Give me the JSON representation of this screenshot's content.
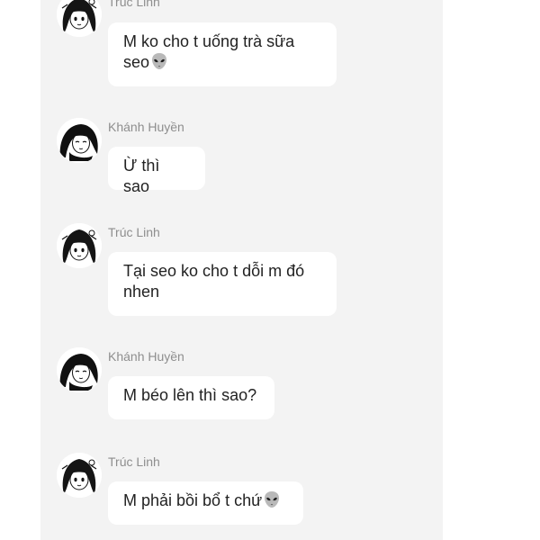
{
  "messages": [
    {
      "sender": "Trúc Linh",
      "avatar_icon": "girl-sketch-avatar-icon",
      "text_lines": [
        "M ko cho t uống trà sữa",
        "seo"
      ],
      "trailing_emoji": "alien-emoji-icon"
    },
    {
      "sender": "Khánh Huyền",
      "avatar_icon": "girl-ink-avatar-icon",
      "text_lines": [
        "Ừ thì sao"
      ]
    },
    {
      "sender": "Trúc Linh",
      "avatar_icon": "girl-sketch-avatar-icon",
      "text_lines": [
        "Tại seo ko cho t dỗi m đó",
        "nhen"
      ]
    },
    {
      "sender": "Khánh Huyền",
      "avatar_icon": "girl-ink-avatar-icon",
      "text_lines": [
        "M béo lên thì sao?"
      ]
    },
    {
      "sender": "Trúc Linh",
      "avatar_icon": "girl-sketch-avatar-icon",
      "text_lines": [
        "M phải bồi bổ t chứ"
      ],
      "trailing_emoji": "alien-emoji-icon"
    }
  ],
  "colors": {
    "panel_background": "#f3f3f3",
    "bubble_background": "#ffffff",
    "sender_name": "#8e8e8e",
    "message_text": "#222222"
  }
}
